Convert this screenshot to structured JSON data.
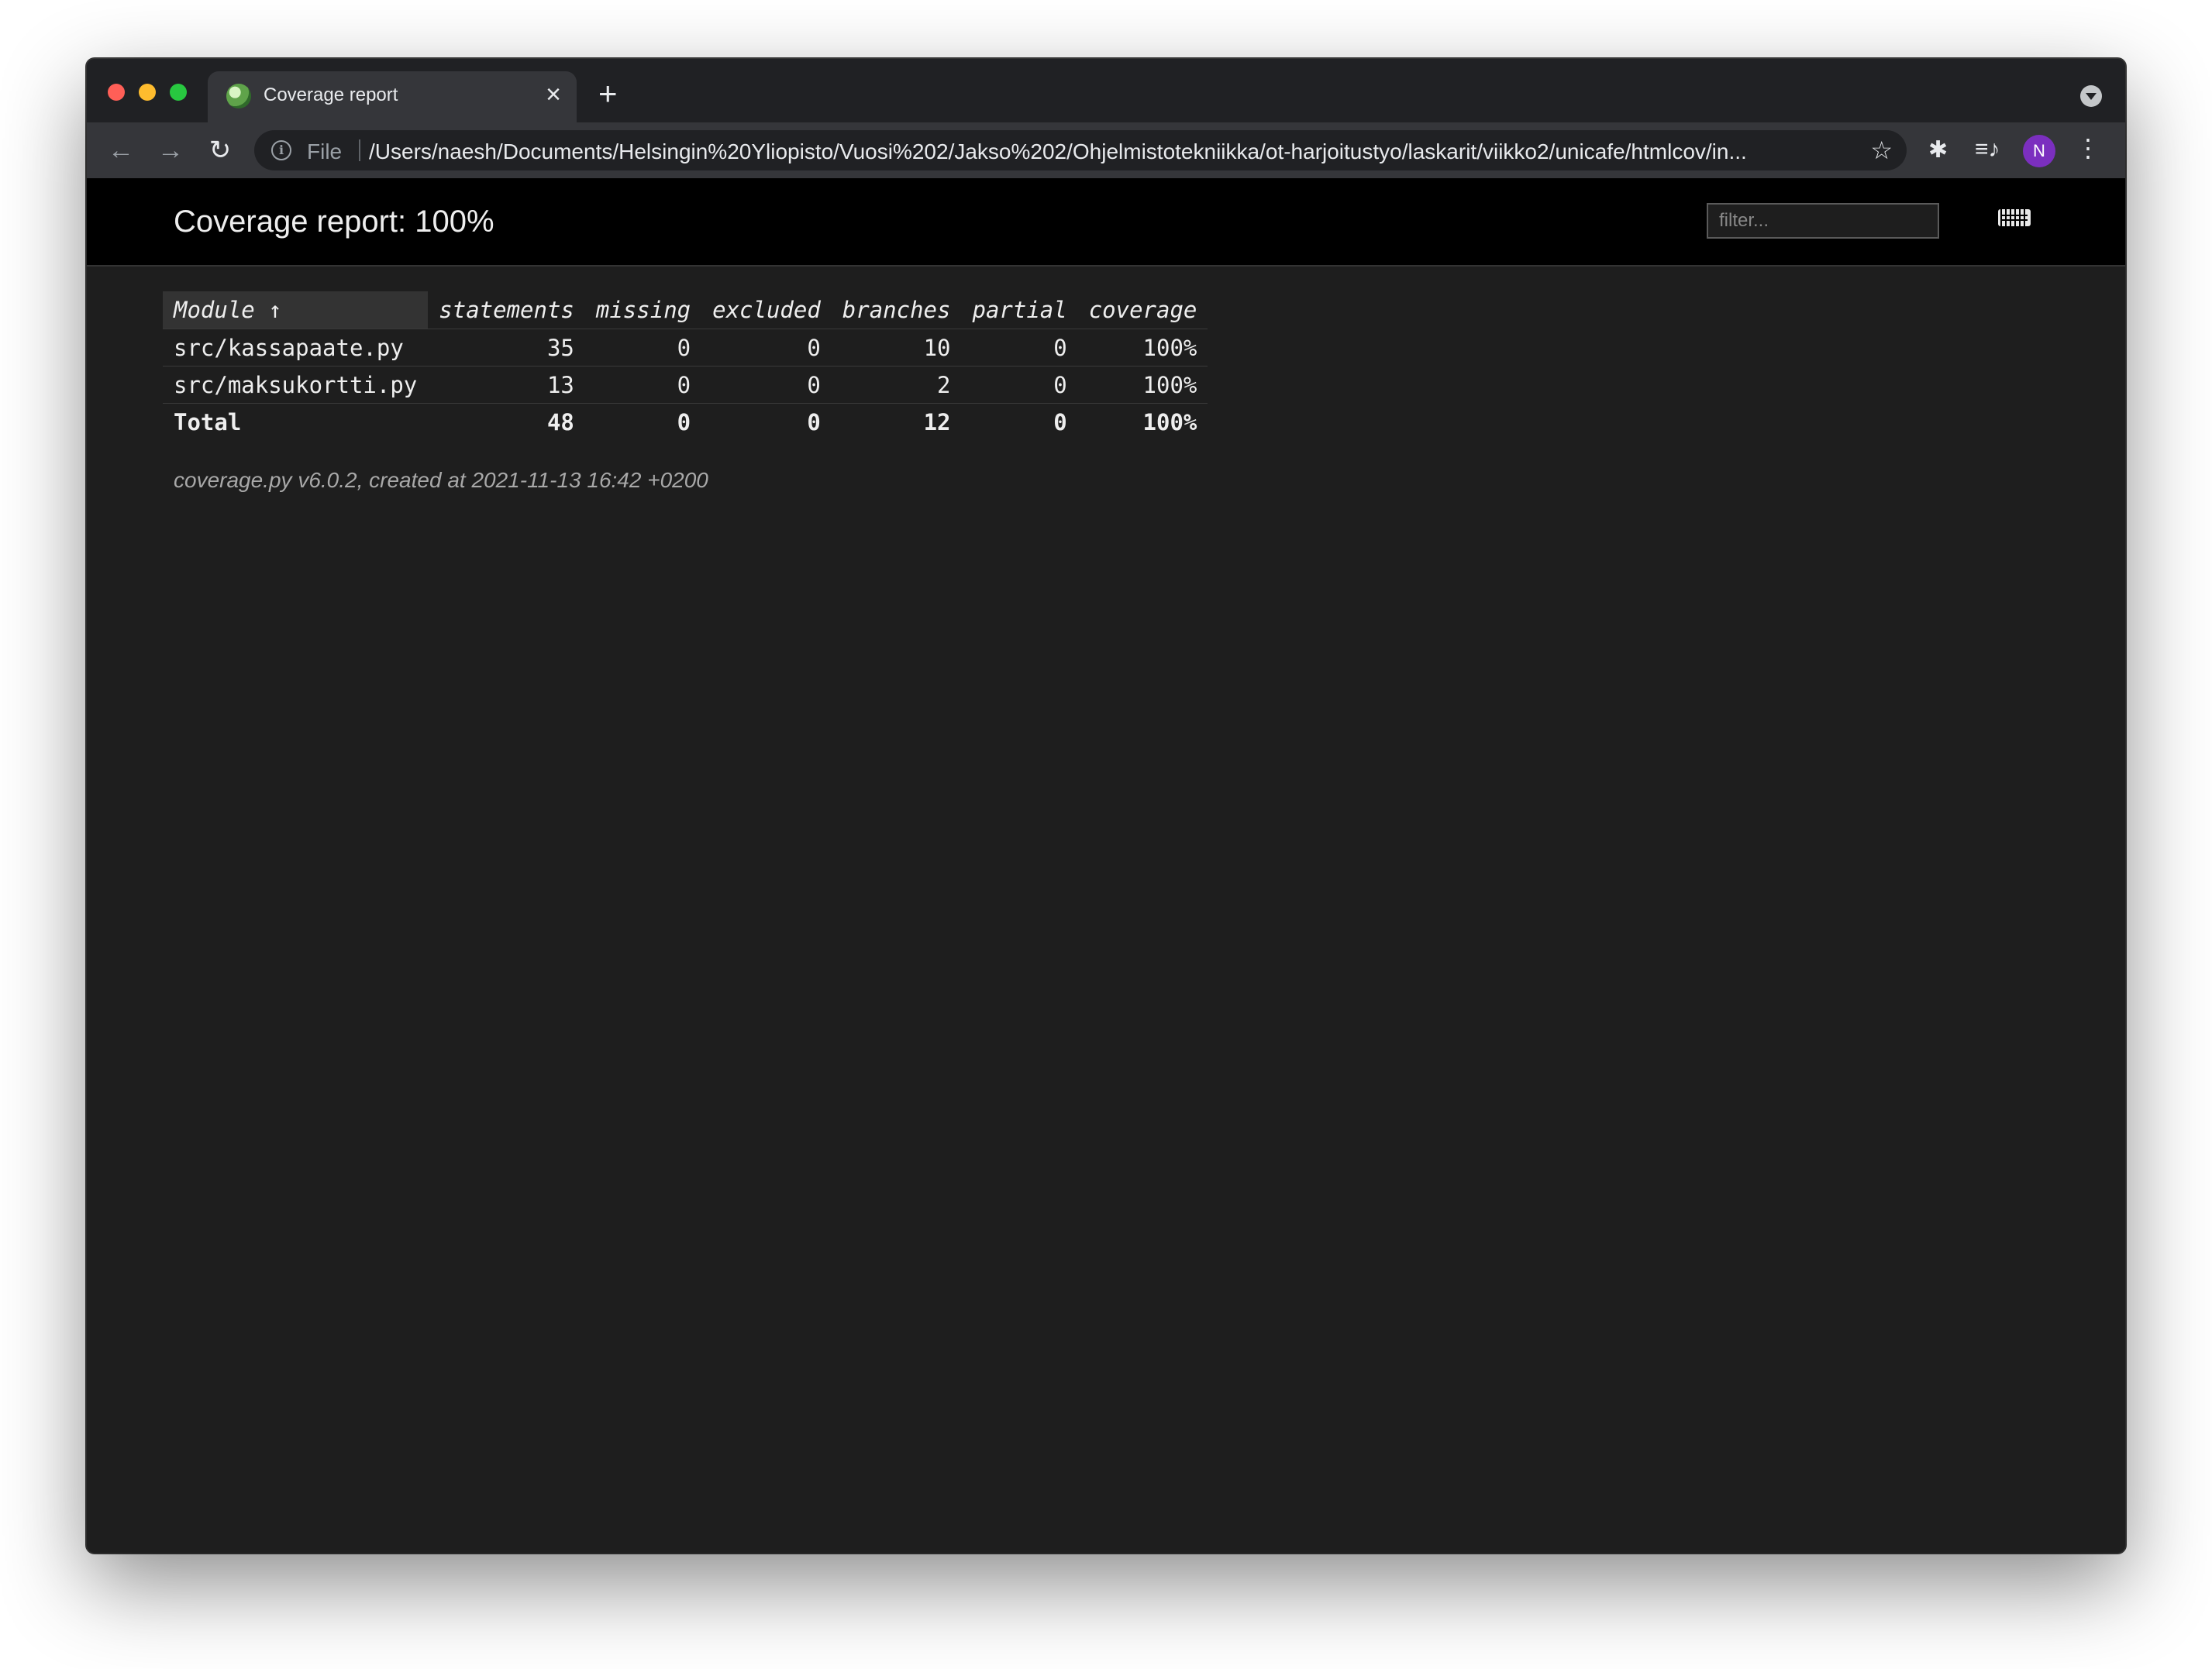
{
  "browser": {
    "tab_title": "Coverage report",
    "tab_close": "×",
    "new_tab": "+",
    "back": "←",
    "forward": "→",
    "reload": "↻",
    "scheme_label": "File",
    "url": "/Users/naesh/Documents/Helsingin%20Yliopisto/Vuosi%202/Jakso%202/Ohjelmistotekniikka/ot-harjoitustyo/laskarit/viikko2/unicafe/htmlcov/in...",
    "star": "☆",
    "extensions": "✱",
    "media": "≡♪",
    "profile_initial": "N",
    "menu": "⋮"
  },
  "header": {
    "title": "Coverage report: 100%",
    "filter_placeholder": "filter..."
  },
  "table": {
    "columns": [
      "Module ↑",
      "statements",
      "missing",
      "excluded",
      "branches",
      "partial",
      "coverage"
    ],
    "rows": [
      [
        "src/kassapaate.py",
        "35",
        "0",
        "0",
        "10",
        "0",
        "100%"
      ],
      [
        "src/maksukortti.py",
        "13",
        "0",
        "0",
        "2",
        "0",
        "100%"
      ]
    ],
    "total": [
      "Total",
      "48",
      "0",
      "0",
      "12",
      "0",
      "100%"
    ]
  },
  "footer": {
    "text": "coverage.py v6.0.2, created at 2021-11-13 16:42 +0200"
  },
  "colors": {
    "page_bg": "#1e1e1e",
    "header_bg": "#000000",
    "text": "#eeeeee",
    "avatar": "#7b2fbf"
  }
}
